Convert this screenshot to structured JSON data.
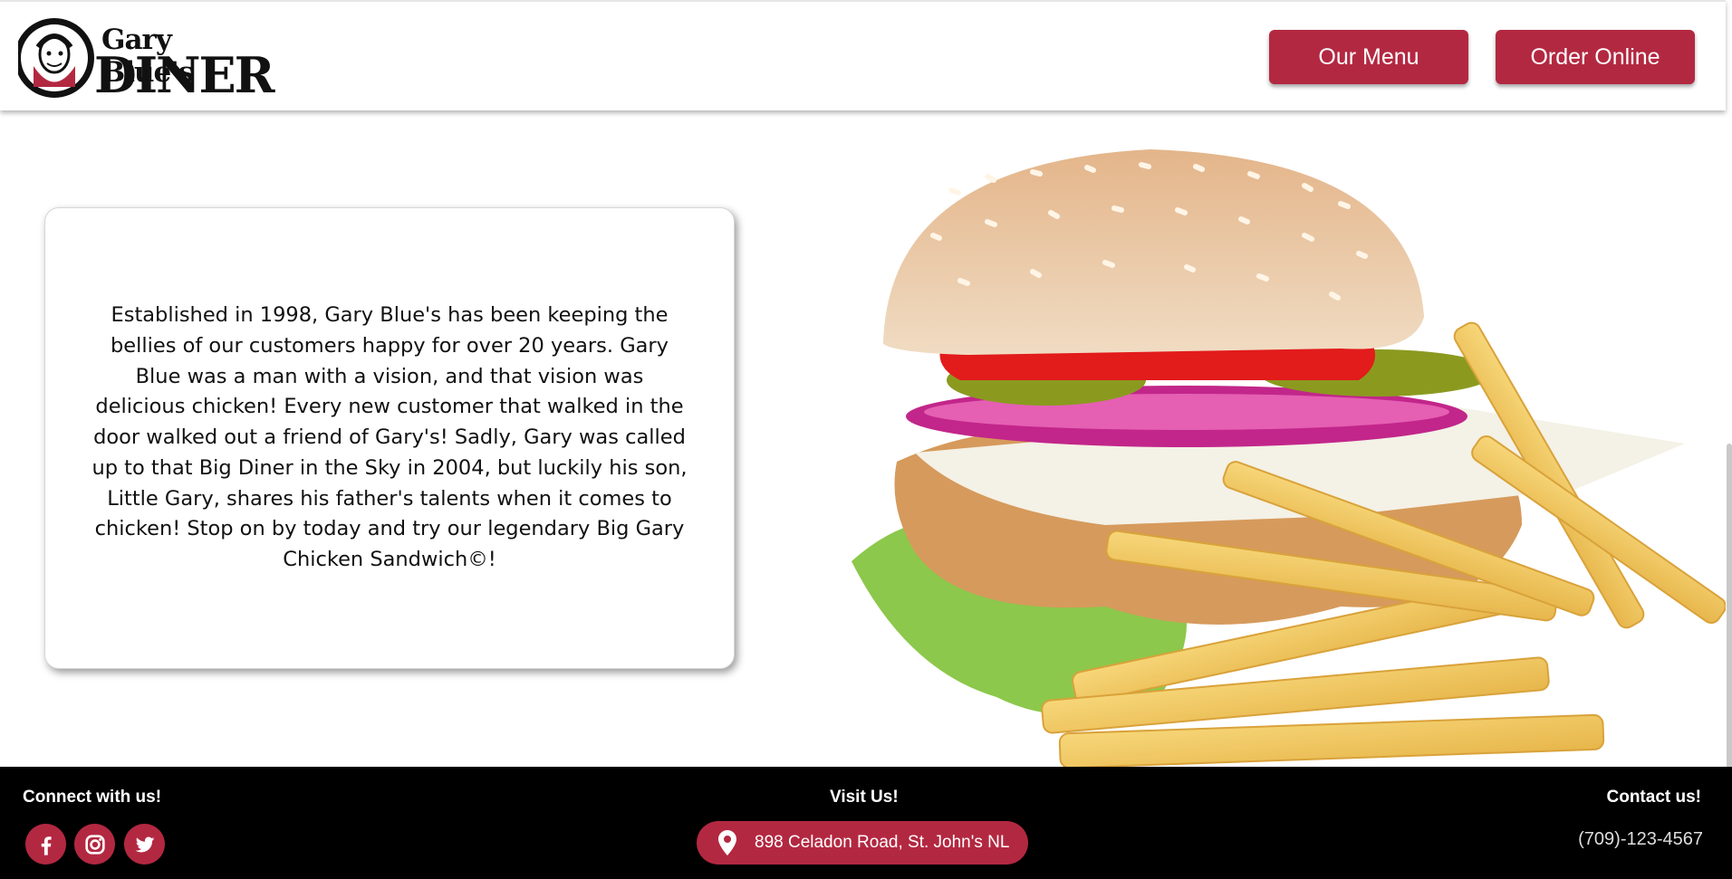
{
  "header": {
    "logo_line1": "Gary Blue's",
    "logo_line2": "DINER",
    "menu_button": "Our Menu",
    "order_button": "Order Online"
  },
  "main": {
    "about_text": "Established in 1998, Gary Blue's has been keeping the bellies of our customers happy for over 20 years. Gary Blue was a man with a vision, and that vision was delicious chicken! Every new customer that walked in the door walked out a friend of Gary's! Sadly, Gary was called up to that Big Diner in the Sky in 2004, but luckily his son, Little Gary, shares his father's talents when it comes to chicken! Stop on by today and try our legendary Big Gary Chicken Sandwich©!"
  },
  "footer": {
    "connect_title": "Connect with us!",
    "visit_title": "Visit Us!",
    "contact_title": "Contact us!",
    "address": "898 Celadon Road, St. John's NL",
    "phone": "(709)-123-4567",
    "social": [
      "facebook-icon",
      "instagram-icon",
      "twitter-icon"
    ]
  },
  "colors": {
    "brand": "#b32841",
    "footer_bg": "#000000"
  }
}
